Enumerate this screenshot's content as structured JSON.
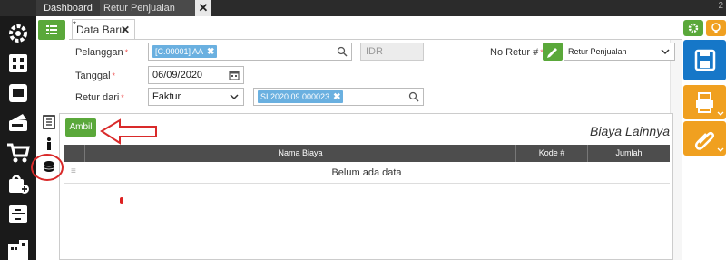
{
  "tabs": {
    "dashboard": "Dashboard",
    "retur": "Retur Penjualan",
    "close": "✕",
    "corner": "2"
  },
  "doc_tab": {
    "star": "*",
    "label": "Data Baru",
    "close": "✕"
  },
  "form": {
    "pelanggan_label": "Pelanggan",
    "pelanggan_value": "[C.00001] AA",
    "currency": "IDR",
    "tanggal_label": "Tanggal",
    "tanggal_value": "06/09/2020",
    "retur_dari_label": "Retur dari",
    "retur_dari_value": "Faktur",
    "faktur_value": "SI.2020.09.000023",
    "no_retur_label": "No Retur #",
    "no_retur_value": "Retur Penjualan",
    "required_mark": "*"
  },
  "main": {
    "ambil_label": "Ambil",
    "section_title": "Biaya Lainnya",
    "columns": [
      "Nama Biaya",
      "Kode #",
      "Jumlah"
    ],
    "empty_text": "Belum ada data"
  },
  "colors": {
    "green": "#5aa83a",
    "blue": "#1677c8",
    "orange": "#f0a020",
    "annotation_red": "#d92a2a"
  },
  "icons": {
    "sidebar": [
      "gear-icon",
      "grid-icon",
      "wallet-icon",
      "card-icon",
      "cart-icon",
      "bag-plus-icon",
      "archive-icon",
      "building-icon"
    ],
    "right": [
      "gear-icon",
      "lightbulb-icon",
      "save-icon",
      "printer-icon",
      "paperclip-icon"
    ]
  }
}
